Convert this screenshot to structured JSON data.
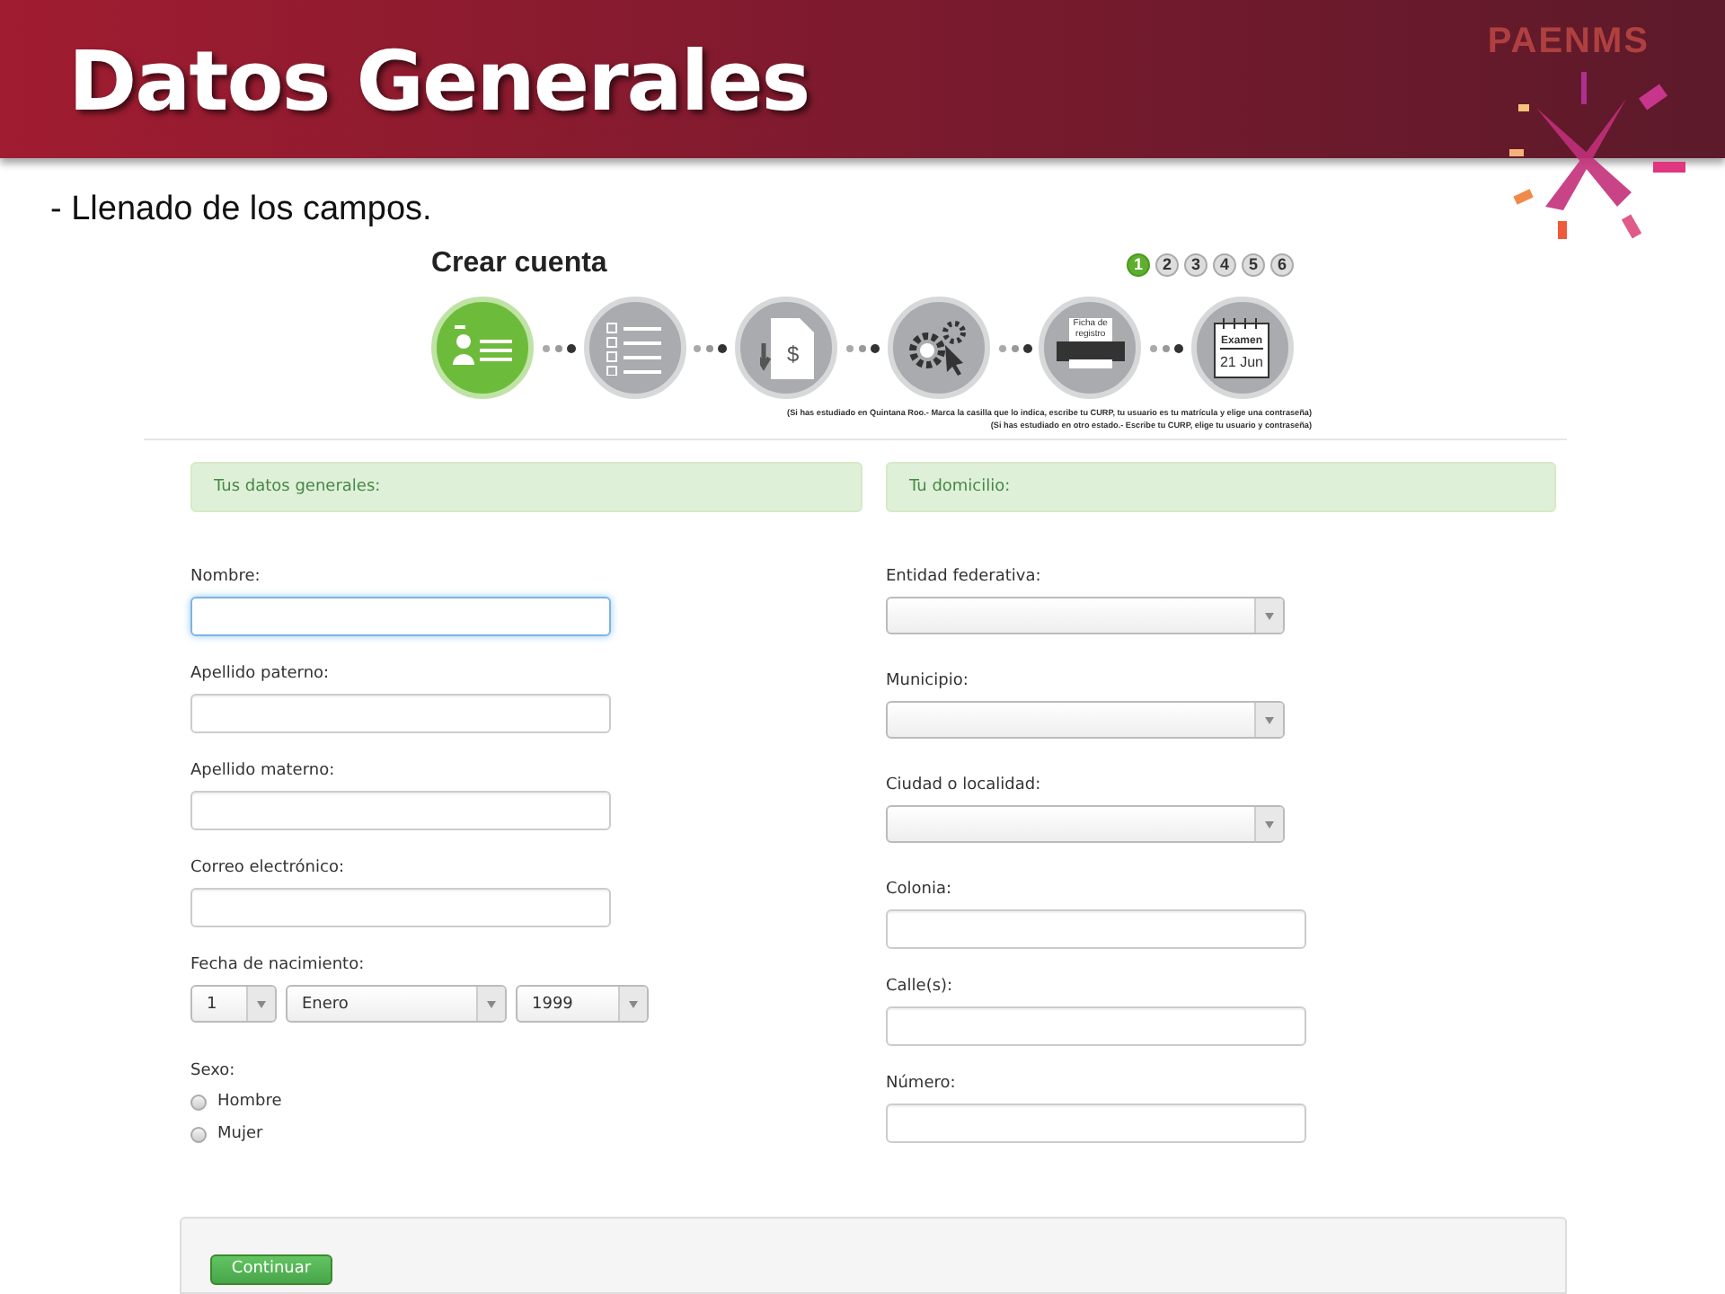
{
  "slide": {
    "title": "Datos Generales",
    "brand": "PAENMS",
    "subtitle": "- Llenado de los campos."
  },
  "wizard": {
    "title": "Crear cuenta",
    "steps": [
      {
        "label": "1",
        "selected": true
      },
      {
        "label": "2",
        "selected": false
      },
      {
        "label": "3",
        "selected": false
      },
      {
        "label": "4",
        "selected": false
      },
      {
        "label": "5",
        "selected": false
      },
      {
        "label": "6",
        "selected": false
      }
    ],
    "stages": [
      {
        "kind": "id-card",
        "selected": true
      },
      {
        "kind": "checklist",
        "selected": false
      },
      {
        "kind": "payment",
        "selected": false,
        "label": "$"
      },
      {
        "kind": "settings",
        "selected": false
      },
      {
        "kind": "printer",
        "selected": false,
        "label": "Ficha de registro"
      },
      {
        "kind": "calendar",
        "selected": false,
        "label": "Examen",
        "date": "21 Jun"
      }
    ],
    "notes": [
      "(Si has estudiado en Quintana Roo.- Marca la casilla que lo indica, escribe tu CURP, tu usuario es tu matrícula y elige una contraseña)",
      "(Si has estudiado en otro estado.- Escribe tu CURP, elige tu usuario y contraseña)"
    ]
  },
  "form": {
    "columns": [
      {
        "header": "Tus datos generales:",
        "fields": [
          {
            "kind": "text",
            "label": "Nombre:",
            "focused": true
          },
          {
            "kind": "text",
            "label": "Apellido paterno:",
            "focused": false
          },
          {
            "kind": "text",
            "label": "Apellido materno:",
            "focused": false
          },
          {
            "kind": "text",
            "label": "Correo electrónico:",
            "focused": false
          },
          {
            "kind": "date",
            "label": "Fecha de nacimiento:",
            "selects": [
              "1",
              "Enero",
              "1999"
            ]
          },
          {
            "kind": "radio",
            "label": "Sexo:",
            "options": [
              {
                "label": "Hombre",
                "selected": false
              },
              {
                "label": "Mujer",
                "selected": false
              }
            ]
          }
        ]
      },
      {
        "header": "Tu domicilio:",
        "fields": [
          {
            "kind": "select",
            "label": "Entidad federativa:"
          },
          {
            "kind": "select",
            "label": "Municipio:"
          },
          {
            "kind": "select",
            "label": "Ciudad o localidad:"
          },
          {
            "kind": "text",
            "label": "Colonia:",
            "focused": false
          },
          {
            "kind": "text",
            "label": "Calle(s):",
            "focused": false
          },
          {
            "kind": "text",
            "label": "Número:",
            "focused": false
          }
        ]
      }
    ]
  },
  "button": "Continuar"
}
